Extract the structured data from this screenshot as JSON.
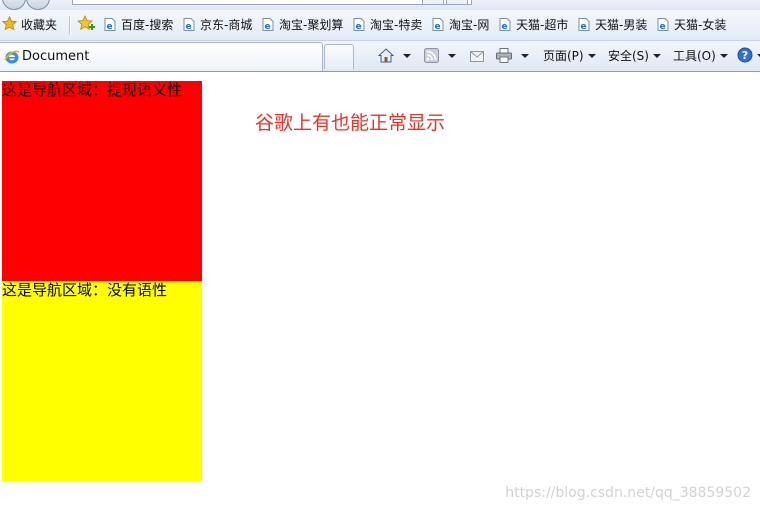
{
  "favorites_bar": {
    "favorites_label": "收藏夹",
    "links": [
      {
        "label": "百度-搜索"
      },
      {
        "label": "京东-商城"
      },
      {
        "label": "淘宝-聚划算"
      },
      {
        "label": "淘宝-特卖"
      },
      {
        "label": "淘宝-网"
      },
      {
        "label": "天猫-超市"
      },
      {
        "label": "天猫-男装"
      },
      {
        "label": "天猫-女装"
      }
    ]
  },
  "tab": {
    "title": "Document"
  },
  "command_bar": {
    "page_menu": "页面(P)",
    "safety_menu": "安全(S)",
    "tools_menu": "工具(O)"
  },
  "page": {
    "nav_semantic_text": "这是导航区域：提现语义性",
    "nav_plain_text": "这是导航区域：没有语性",
    "note_text": "谷歌上有也能正常显示",
    "nav_semantic_color": "#ff0000",
    "nav_plain_color": "#ffff00",
    "note_color": "#e8332a"
  },
  "watermark": "https://blog.csdn.net/qq_38859502"
}
